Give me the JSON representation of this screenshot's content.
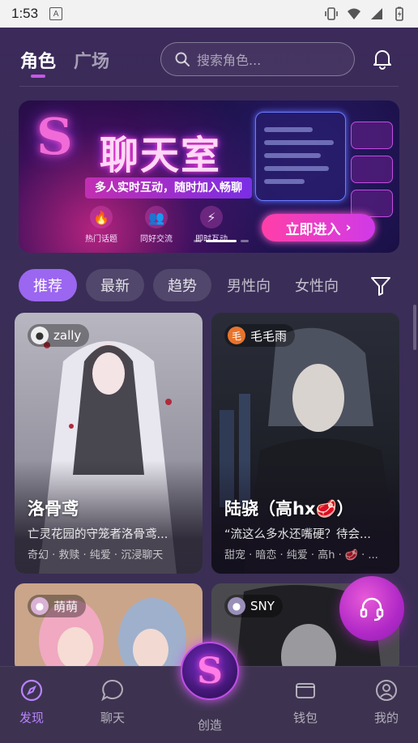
{
  "status_bar": {
    "time": "1:53",
    "notification_icon_letter": "A"
  },
  "header": {
    "tabs": [
      {
        "label": "角色",
        "active": true
      },
      {
        "label": "广场",
        "active": false
      }
    ],
    "search_placeholder": "搜索角色..."
  },
  "banner": {
    "logo_letter": "S",
    "title": "聊天室",
    "subtitle": "多人实时互动，随时加入畅聊",
    "features": [
      "热门话题",
      "同好交流",
      "即时互动"
    ],
    "cta_label": "立即进入",
    "page_index": 2,
    "page_count": 3
  },
  "filters": {
    "chips": [
      "推荐",
      "最新",
      "趋势",
      "男性向",
      "女性向"
    ],
    "selected": "推荐"
  },
  "cards": [
    {
      "author": "zally",
      "name": "洛骨鸢",
      "desc": "亡灵花园的守笼者洛骨鸢...",
      "tags": "奇幻 · 救赎 · 纯爱 · 沉浸聊天"
    },
    {
      "author": "毛毛雨",
      "author_avatar_char": "毛",
      "name": "陆骁（高hx🥩）",
      "desc": "“流这么多水还嘴硬？待会...",
      "tags": "甜宠 · 暗恋 · 纯爱 · 高h · 🥩 · ..."
    },
    {
      "author": "萌萌"
    },
    {
      "author": "SNY"
    }
  ],
  "bottom_nav": {
    "items": [
      "发现",
      "聊天",
      "创造",
      "钱包",
      "我的"
    ],
    "active": "发现",
    "create_letter": "S"
  },
  "colors": {
    "accent": "#9b66f0",
    "brand_pink": "#d03ae8",
    "active_nav": "#b983ff"
  }
}
